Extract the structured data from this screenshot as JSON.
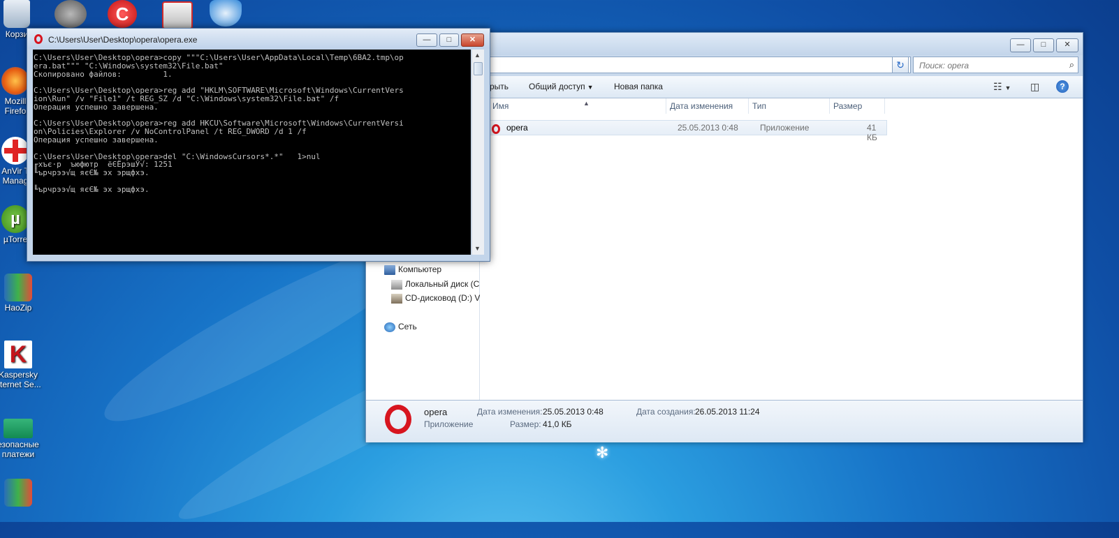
{
  "desktop": {
    "icons": [
      {
        "label": "Корзи"
      },
      {
        "label": "Mozill\nFirefo"
      },
      {
        "label": "AnVir T\nManag"
      },
      {
        "label": "µTorre"
      },
      {
        "label": "HaoZip"
      },
      {
        "label": "Kaspersky\nnternet Se..."
      },
      {
        "label": "езопасные\nплатежи"
      },
      {
        "label": ""
      }
    ]
  },
  "console": {
    "title": "C:\\Users\\User\\Desktop\\opera\\opera.exe",
    "text": "C:\\Users\\User\\Desktop\\opera>copy \"\"\"C:\\Users\\User\\AppData\\Local\\Temp\\6BA2.tmp\\op\nera.bat\"\"\" \"C:\\Windows\\system32\\File.bat\"\nСкопировано файлов:         1.\n\nC:\\Users\\User\\Desktop\\opera>reg add \"HKLM\\SOFTWARE\\Microsoft\\Windows\\CurrentVers\nion\\Run\" /v \"File1\" /t REG_SZ /d \"C:\\Windows\\system32\\File.bat\" /f\nОперация успешно завершена.\n\nC:\\Users\\User\\Desktop\\opera>reg add HKCU\\Software\\Microsoft\\Windows\\CurrentVersi\non\\Policies\\Explorer /v NoControlPanel /t REG_DWORD /d 1 /f\nОперация успешно завершена.\n\nC:\\Users\\User\\Desktop\\opera>del \"C:\\WindowsCursors*.*\"   1>nul\n╓хъє·р  ъюфютр  ёЄЁрэшЎ√: 1251\n╙ърчрээ√щ яєЄ№ эх эрщфхэ.\n\n╙ърчрээ√щ яєЄ№ эх эрщфхэ.",
    "min": "—",
    "max": "□",
    "close": "✕"
  },
  "explorer": {
    "buttons": {
      "min": "—",
      "max": "□",
      "close": "✕"
    },
    "refresh_glyph": "↻",
    "search_placeholder": "Поиск: opera",
    "toolbar": {
      "open_partial": "рыть",
      "share": "Общий доступ",
      "new_folder": "Новая папка"
    },
    "columns": {
      "name": "Имя",
      "date": "Дата изменения",
      "type": "Тип",
      "size": "Размер"
    },
    "files": [
      {
        "name": "opera",
        "date": "25.05.2013 0:48",
        "type": "Приложение",
        "size": "41 КБ"
      }
    ],
    "nav": {
      "computer": "Компьютер",
      "local_disk": "Локальный диск (C",
      "cd_drive": "CD-дисковод (D:) Vi",
      "network": "Сеть"
    },
    "details": {
      "name": "opera",
      "kind": "Приложение",
      "modified_label": "Дата изменения:",
      "modified_value": "25.05.2013 0:48",
      "size_label": "Размер:",
      "size_value": "41,0 КБ",
      "created_label": "Дата создания:",
      "created_value": "26.05.2013 11:24"
    }
  },
  "colors": {
    "opera_red": "#d7151f",
    "console_text": "#c0c0c0",
    "console_bg": "#000000"
  }
}
